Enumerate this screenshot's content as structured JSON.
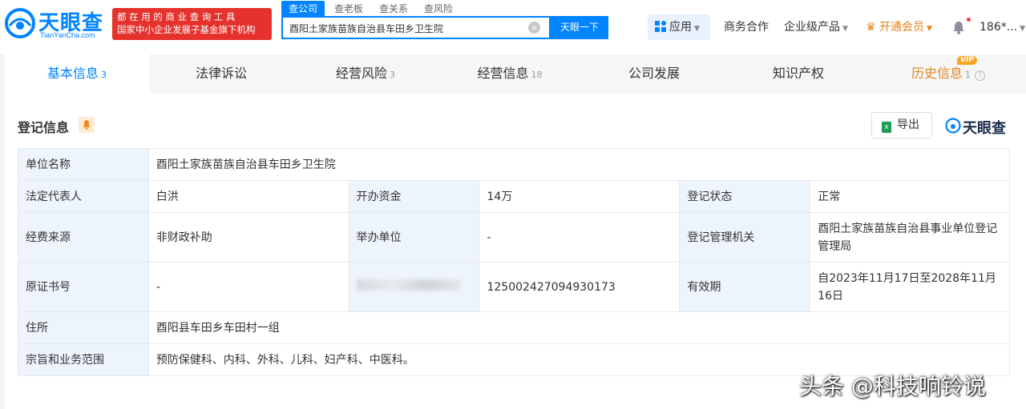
{
  "header": {
    "logo": {
      "name": "天眼查",
      "sub": "TianYanCha.com"
    },
    "promo": {
      "line1": "都在用的商业查询工具",
      "line2": "国家中小企业发展子基金旗下机构"
    },
    "search_tabs": [
      "查公司",
      "查老板",
      "查关系",
      "查风险"
    ],
    "search_value": "酉阳土家族苗族自治县车田乡卫生院",
    "search_button": "天眼一下",
    "nav": {
      "apps": "应用",
      "business": "商务合作",
      "enterprise": "企业级产品",
      "vip": "开通会员",
      "user": "186*..."
    }
  },
  "tabs": [
    {
      "label": "基本信息",
      "count": "3"
    },
    {
      "label": "法律诉讼",
      "count": ""
    },
    {
      "label": "经营风险",
      "count": "3"
    },
    {
      "label": "经营信息",
      "count": "18"
    },
    {
      "label": "公司发展",
      "count": ""
    },
    {
      "label": "知识产权",
      "count": ""
    },
    {
      "label": "历史信息",
      "count": "1",
      "badge": "VIP"
    }
  ],
  "section": {
    "title": "登记信息",
    "export_label": "导出",
    "brand": "天眼查"
  },
  "registration": {
    "unit_name_label": "单位名称",
    "unit_name": "酉阳土家族苗族自治县车田乡卫生院",
    "legal_rep_label": "法定代表人",
    "legal_rep": "白洪",
    "capital_label": "开办资金",
    "capital": "14万",
    "status_label": "登记状态",
    "status": "正常",
    "funding_label": "经费来源",
    "funding": "非财政补助",
    "sponsor_label": "举办单位",
    "sponsor": "-",
    "authority_label": "登记管理机关",
    "authority": "酉阳土家族苗族自治县事业单位登记管理局",
    "cert_label": "原证书号",
    "cert": "-",
    "credit_code": "125002427094930173",
    "validity_label": "有效期",
    "validity": "自2023年11月17日至2028年11月16日",
    "address_label": "住所",
    "address": "酉阳县车田乡车田村一组",
    "scope_label": "宗旨和业务范围",
    "scope": "预防保健科、内科、外科、儿科、妇产科、中医科。"
  },
  "watermark": "头条 @科技响铃说",
  "colors": {
    "accent": "#0084ff",
    "promo": "#e5322d",
    "vip": "#e6851c",
    "label_bg": "#eef4fc"
  }
}
